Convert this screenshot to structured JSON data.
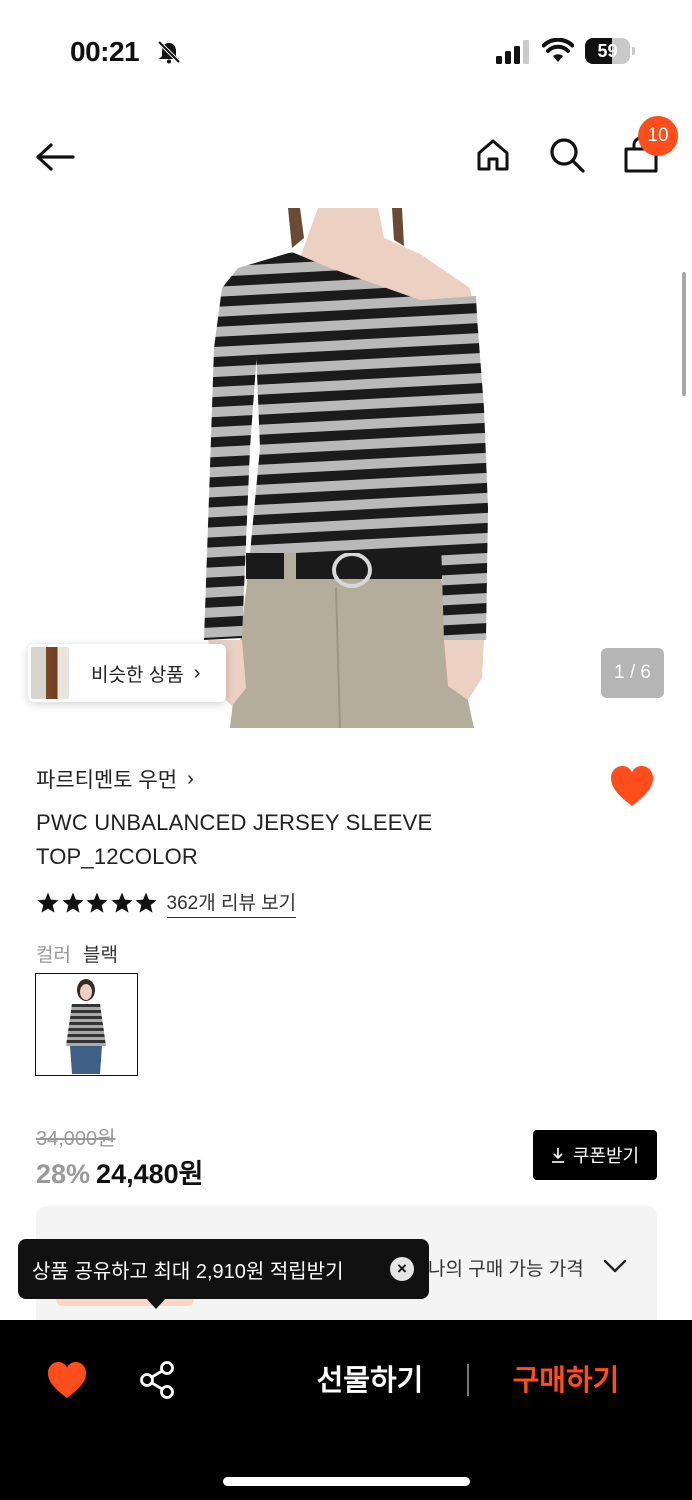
{
  "status_bar": {
    "time": "00:21",
    "battery": "59",
    "battery_level": 0.59,
    "icons": [
      "bell-slash-icon",
      "signal-icon",
      "wifi-icon",
      "battery-icon"
    ]
  },
  "header": {
    "icons": [
      "back-arrow-icon",
      "home-icon",
      "search-icon",
      "shopping-bag-icon"
    ],
    "cart_count": "10"
  },
  "gallery": {
    "similar_label": "비슷한 상품",
    "similar_chevron": "›",
    "page_indicator": "1 / 6"
  },
  "product": {
    "brand": "파르티멘토 우먼",
    "brand_chevron": "›",
    "title": "PWC UNBALANCED JERSEY SLEEVE TOP_12COLOR",
    "rating": 5,
    "review_link": "362개 리뷰 보기",
    "color_label": "컬러",
    "color_value": "블랙"
  },
  "price": {
    "original": "34,000원",
    "discount": "28%",
    "final": "24,480원",
    "coupon_label": "쿠폰받기"
  },
  "my_price": {
    "label": "나의 구매 가능 가격"
  },
  "toast": {
    "message": "상품 공유하고 최대 2,910원 적립받기",
    "close": "×"
  },
  "bottom_bar": {
    "gift_label": "선물하기",
    "buy_label": "구매하기"
  },
  "colors": {
    "accent": "#ff4d1c",
    "dark": "#000000"
  }
}
